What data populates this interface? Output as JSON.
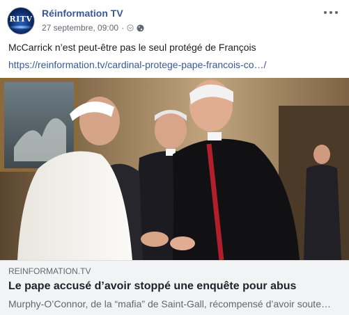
{
  "post": {
    "page_name": "Réinformation TV",
    "avatar_text": "RITV",
    "timestamp": "27 septembre, 09:00",
    "separator": "·",
    "icons": {
      "more": "more-options-icon",
      "audience": "globe-icon",
      "chevron": "chevron-down-icon"
    },
    "message": "McCarrick n’est peut-être pas le seul protégé de François",
    "link_url": "https://reinformation.tv/cardinal-protege-pape-francois-co…/"
  },
  "link_preview": {
    "domain": "REINFORMATION.TV",
    "title": "Le pape accusé d’avoir stoppé une enquête pour abus",
    "description": "Murphy-O’Connor, de la “mafia” de Saint-Gall, récompensé d’avoir soute…"
  },
  "colors": {
    "link_blue": "#385898",
    "meta_gray": "#616770",
    "preview_bg": "#f2f3f5"
  }
}
